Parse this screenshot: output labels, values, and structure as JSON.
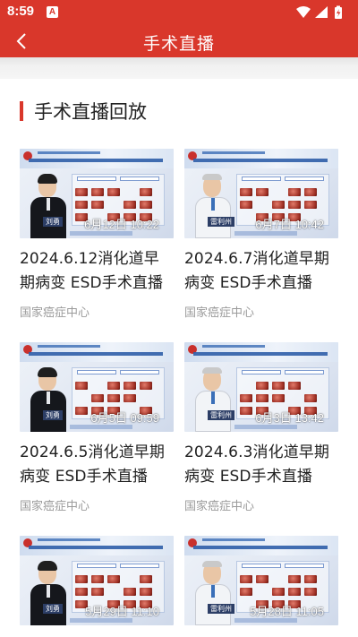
{
  "status_bar": {
    "time": "8:59",
    "notification": "A"
  },
  "header": {
    "title": "手术直播",
    "back_icon": "chevron-left-icon"
  },
  "section": {
    "title": "手术直播回放",
    "accent_color": "#d9372b"
  },
  "videos": [
    {
      "overlay": "6月12日 10:22",
      "title": "2024.6.12消化道早期病变 ESD手术直播",
      "source": "国家癌症中心",
      "speaker": "刘勇",
      "look": "young"
    },
    {
      "overlay": "6月7日 10:42",
      "title": "2024.6.7消化道早期病变 ESD手术直播",
      "source": "国家癌症中心",
      "speaker": "雷利州",
      "look": "senior"
    },
    {
      "overlay": "6月5日 09:59",
      "title": "2024.6.5消化道早期病变 ESD手术直播",
      "source": "国家癌症中心",
      "speaker": "刘勇",
      "look": "young"
    },
    {
      "overlay": "6月3日 13:42",
      "title": "2024.6.3消化道早期病变 ESD手术直播",
      "source": "国家癌症中心",
      "speaker": "雷利州",
      "look": "senior"
    },
    {
      "overlay": "5月29日 11:10",
      "title": "",
      "source": "",
      "speaker": "刘勇",
      "look": "young"
    },
    {
      "overlay": "5月28日 11:05",
      "title": "",
      "source": "",
      "speaker": "雷利州",
      "look": "senior"
    }
  ],
  "colors": {
    "brand": "#d9372b",
    "muted_text": "#9b9b9b"
  }
}
